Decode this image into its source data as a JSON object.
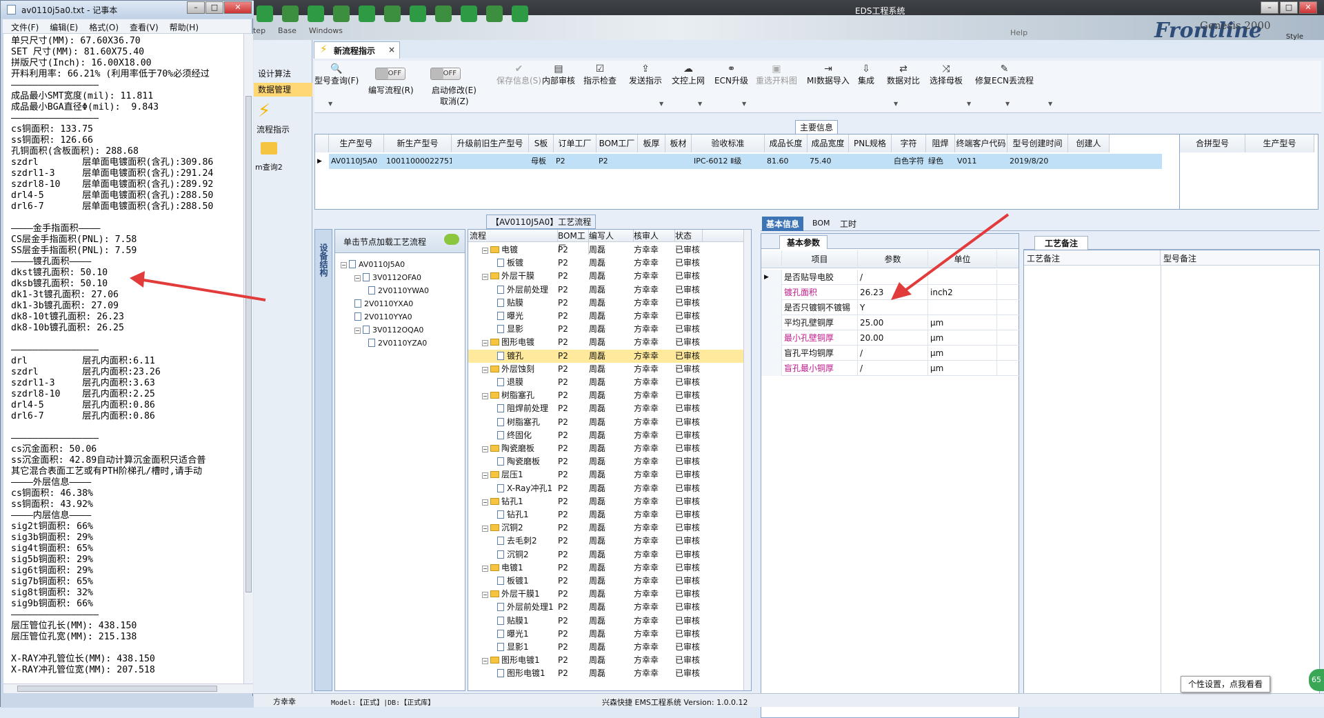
{
  "app": {
    "title": "EDS工程系统",
    "brand": "Frontline",
    "brand2": "Genesis 2000",
    "style_label": "Style",
    "menu_items": [
      "Step",
      "Base",
      "Windows"
    ],
    "menu_right": "Help"
  },
  "notepad": {
    "title": "av0110j5a0.txt - 记事本",
    "menu": [
      "文件(F)",
      "编辑(E)",
      "格式(O)",
      "查看(V)",
      "帮助(H)"
    ],
    "lines": [
      "单只尺寸(MM): 67.60X36.70",
      "SET 尺寸(MM): 81.60X75.40",
      "拼版尺寸(Inch): 16.00X18.00",
      "开料利用率: 66.21% (利用率低于70%必须经过",
      "————————————————",
      "成品最小SMT宽度(mil): 11.811",
      "成品最小BGA直径Φ(mil):  9.843",
      "————————————————",
      "cs铜面积: 133.75",
      "ss铜面积: 126.66",
      "孔铜面积(含板面积): 288.68",
      "szdrl        层单面电镀面积(含孔):309.86",
      "szdrl1-3     层单面电镀面积(含孔):291.24",
      "szdrl8-10    层单面电镀面积(含孔):289.92",
      "drl4-5       层单面电镀面积(含孔):288.50",
      "drl6-7       层单面电镀面积(含孔):288.50",
      "",
      "————金手指面积————",
      "CS层金手指面积(PNL): 7.58",
      "SS层金手指面积(PNL): 7.59",
      "————镀孔面积————",
      "dkst镀孔面积: 50.10",
      "dksb镀孔面积: 50.10",
      "dk1-3t镀孔面积: 27.06",
      "dk1-3b镀孔面积: 27.09",
      "dk8-10t镀孔面积: 26.23",
      "dk8-10b镀孔面积: 26.25",
      "",
      "————————————————",
      "drl          层孔内面积:6.11",
      "szdrl        层孔内面积:23.26",
      "szdrl1-3     层孔内面积:3.63",
      "szdrl8-10    层孔内面积:2.25",
      "drl4-5       层孔内面积:0.86",
      "drl6-7       层孔内面积:0.86",
      "",
      "————————————————",
      "cs沉金面积: 50.06",
      "ss沉金面积: 42.89自动计算沉金面积只适合普",
      "其它混合表面工艺或有PTH阶梯孔/槽时,请手动",
      "————外层信息————",
      "cs铜面积: 46.38%",
      "ss铜面积: 43.92%",
      "————内层信息————",
      "sig2t铜面积: 66%",
      "sig3b铜面积: 29%",
      "sig4t铜面积: 65%",
      "sig5b铜面积: 29%",
      "sig6t铜面积: 29%",
      "sig7b铜面积: 65%",
      "sig8t铜面积: 32%",
      "sig9b铜面积: 66%",
      "————————————————",
      "层压管位孔长(MM): 438.150",
      "层压管位孔宽(MM): 215.138",
      "",
      "X-RAY冲孔管位长(MM): 438.150",
      "X-RAY冲孔管位宽(MM): 207.518"
    ]
  },
  "nav": {
    "items": [
      "设计算法",
      "数据管理",
      "流程指示",
      "m查询2"
    ]
  },
  "tab": {
    "label": "新流程指示",
    "close": "×"
  },
  "toolbar": {
    "items": [
      {
        "label": "型号查询(F)",
        "icon": "search-icon",
        "enabled": true
      },
      {
        "label": "编写流程(R)",
        "icon": "toggle",
        "enabled": true
      },
      {
        "label": "启动修改(E)",
        "icon": "toggle",
        "enabled": true
      },
      {
        "label": "保存信息(S)",
        "icon": "check-icon",
        "enabled": false
      },
      {
        "label": "内部审核",
        "icon": "print-icon",
        "enabled": true
      },
      {
        "label": "指示检查",
        "icon": "checklist-icon",
        "enabled": true
      },
      {
        "label": "发送指示",
        "icon": "upload-icon",
        "enabled": true
      },
      {
        "label": "文控上网",
        "icon": "cloud-icon",
        "enabled": true
      },
      {
        "label": "ECN升级",
        "icon": "binoculars-icon",
        "enabled": true
      },
      {
        "label": "重选开料图",
        "icon": "image-icon",
        "enabled": false
      },
      {
        "label": "MI数据导入",
        "icon": "import-icon",
        "enabled": true
      },
      {
        "label": "集成",
        "icon": "download-icon",
        "enabled": true
      },
      {
        "label": "数据对比",
        "icon": "compare-icon",
        "enabled": true
      },
      {
        "label": "选择母板",
        "icon": "shuffle-icon",
        "enabled": true
      },
      {
        "label": "修复ECN丢流程",
        "icon": "wrench-icon",
        "enabled": true
      }
    ],
    "toggle_off": "OFF",
    "cancel_label": "取消(Z)"
  },
  "main_info": {
    "title": "主要信息",
    "columns": [
      "生产型号",
      "新生产型号",
      "升级前旧生产型号",
      "S板",
      "订单工厂",
      "BOM工厂",
      "板厚",
      "板材",
      "验收标准",
      "成品长度",
      "成品宽度",
      "PNL规格",
      "字符",
      "阻焊",
      "终端客户代码",
      "型号创建时间",
      "创建人"
    ],
    "row": [
      "AV0110J5A0",
      "10011000022751",
      "",
      "母板",
      "P2",
      "P2",
      "",
      "",
      "IPC-6012 Ⅱ级",
      "81.60",
      "75.40",
      "",
      "白色字符",
      "绿色",
      "V011",
      "2019/8/20",
      ""
    ],
    "right_columns": [
      "合拼型号",
      "生产型号"
    ]
  },
  "tree": {
    "header": "单击节点加载工艺流程",
    "side_label": "设备结构",
    "nodes": [
      "AV0110J5A0",
      "3V0112OFA0",
      "2V0110YWA0",
      "2V0110YXA0",
      "2V0110YYA0",
      "3V0112OQA0",
      "2V0110YZA0"
    ]
  },
  "flow": {
    "title": "【AV0110J5A0】工艺流程",
    "columns": [
      "流程",
      "BOM工厂",
      "编写人",
      "核审人",
      "状态"
    ],
    "rows": [
      {
        "name": "电镀",
        "type": "folder",
        "bom": "P2",
        "writer": "周磊",
        "reviewer": "方幸幸",
        "status": "已审核"
      },
      {
        "name": "板镀",
        "type": "doc",
        "bom": "P2",
        "writer": "周磊",
        "reviewer": "方幸幸",
        "status": "已审核"
      },
      {
        "name": "外层干膜",
        "type": "folder",
        "bom": "P2",
        "writer": "周磊",
        "reviewer": "方幸幸",
        "status": "已审核"
      },
      {
        "name": "外层前处理",
        "type": "doc",
        "bom": "P2",
        "writer": "周磊",
        "reviewer": "方幸幸",
        "status": "已审核"
      },
      {
        "name": "贴膜",
        "type": "doc",
        "bom": "P2",
        "writer": "周磊",
        "reviewer": "方幸幸",
        "status": "已审核"
      },
      {
        "name": "曝光",
        "type": "doc",
        "bom": "P2",
        "writer": "周磊",
        "reviewer": "方幸幸",
        "status": "已审核"
      },
      {
        "name": "显影",
        "type": "doc",
        "bom": "P2",
        "writer": "周磊",
        "reviewer": "方幸幸",
        "status": "已审核"
      },
      {
        "name": "图形电镀",
        "type": "folder",
        "bom": "P2",
        "writer": "周磊",
        "reviewer": "方幸幸",
        "status": "已审核"
      },
      {
        "name": "镀孔",
        "type": "doc",
        "bom": "P2",
        "writer": "周磊",
        "reviewer": "方幸幸",
        "status": "已审核",
        "selected": true
      },
      {
        "name": "外层蚀刻",
        "type": "folder",
        "bom": "P2",
        "writer": "周磊",
        "reviewer": "方幸幸",
        "status": "已审核"
      },
      {
        "name": "退膜",
        "type": "doc",
        "bom": "P2",
        "writer": "周磊",
        "reviewer": "方幸幸",
        "status": "已审核"
      },
      {
        "name": "树脂塞孔",
        "type": "folder",
        "bom": "P2",
        "writer": "周磊",
        "reviewer": "方幸幸",
        "status": "已审核"
      },
      {
        "name": "阻焊前处理",
        "type": "doc",
        "bom": "P2",
        "writer": "周磊",
        "reviewer": "方幸幸",
        "status": "已审核"
      },
      {
        "name": "树脂塞孔",
        "type": "doc",
        "bom": "P2",
        "writer": "周磊",
        "reviewer": "方幸幸",
        "status": "已审核"
      },
      {
        "name": "终固化",
        "type": "doc",
        "bom": "P2",
        "writer": "周磊",
        "reviewer": "方幸幸",
        "status": "已审核"
      },
      {
        "name": "陶瓷磨板",
        "type": "folder",
        "bom": "P2",
        "writer": "周磊",
        "reviewer": "方幸幸",
        "status": "已审核"
      },
      {
        "name": "陶瓷磨板",
        "type": "doc",
        "bom": "P2",
        "writer": "周磊",
        "reviewer": "方幸幸",
        "status": "已审核"
      },
      {
        "name": "层压1",
        "type": "folder",
        "bom": "P2",
        "writer": "周磊",
        "reviewer": "方幸幸",
        "status": "已审核"
      },
      {
        "name": "X-Ray冲孔1",
        "type": "doc",
        "bom": "P2",
        "writer": "周磊",
        "reviewer": "方幸幸",
        "status": "已审核"
      },
      {
        "name": "钻孔1",
        "type": "folder",
        "bom": "P2",
        "writer": "周磊",
        "reviewer": "方幸幸",
        "status": "已审核"
      },
      {
        "name": "钻孔1",
        "type": "doc",
        "bom": "P2",
        "writer": "周磊",
        "reviewer": "方幸幸",
        "status": "已审核"
      },
      {
        "name": "沉铜2",
        "type": "folder",
        "bom": "P2",
        "writer": "周磊",
        "reviewer": "方幸幸",
        "status": "已审核"
      },
      {
        "name": "去毛刺2",
        "type": "doc",
        "bom": "P2",
        "writer": "周磊",
        "reviewer": "方幸幸",
        "status": "已审核"
      },
      {
        "name": "沉铜2",
        "type": "doc",
        "bom": "P2",
        "writer": "周磊",
        "reviewer": "方幸幸",
        "status": "已审核"
      },
      {
        "name": "电镀1",
        "type": "folder",
        "bom": "P2",
        "writer": "周磊",
        "reviewer": "方幸幸",
        "status": "已审核"
      },
      {
        "name": "板镀1",
        "type": "doc",
        "bom": "P2",
        "writer": "周磊",
        "reviewer": "方幸幸",
        "status": "已审核"
      },
      {
        "name": "外层干膜1",
        "type": "folder",
        "bom": "P2",
        "writer": "周磊",
        "reviewer": "方幸幸",
        "status": "已审核"
      },
      {
        "name": "外层前处理1",
        "type": "doc",
        "bom": "P2",
        "writer": "周磊",
        "reviewer": "方幸幸",
        "status": "已审核"
      },
      {
        "name": "贴膜1",
        "type": "doc",
        "bom": "P2",
        "writer": "周磊",
        "reviewer": "方幸幸",
        "status": "已审核"
      },
      {
        "name": "曝光1",
        "type": "doc",
        "bom": "P2",
        "writer": "周磊",
        "reviewer": "方幸幸",
        "status": "已审核"
      },
      {
        "name": "显影1",
        "type": "doc",
        "bom": "P2",
        "writer": "周磊",
        "reviewer": "方幸幸",
        "status": "已审核"
      },
      {
        "name": "图形电镀1",
        "type": "folder",
        "bom": "P2",
        "writer": "周磊",
        "reviewer": "方幸幸",
        "status": "已审核"
      },
      {
        "name": "图形电镀1",
        "type": "doc",
        "bom": "P2",
        "writer": "周磊",
        "reviewer": "方幸幸",
        "status": "已审核"
      }
    ]
  },
  "detail_tabs": [
    "基本信息",
    "BOM",
    "工时"
  ],
  "basic": {
    "tab": "基本参数",
    "columns": [
      "项目",
      "参数",
      "单位"
    ],
    "rows": [
      {
        "item": "是否贴导电胶",
        "param": "/",
        "unit": "",
        "pink": false
      },
      {
        "item": "镀孔面积",
        "param": "26.23",
        "unit": "inch2",
        "pink": true
      },
      {
        "item": "是否只镀铜不镀锡",
        "param": "Y",
        "unit": "",
        "pink": false
      },
      {
        "item": "平均孔壁铜厚",
        "param": "25.00",
        "unit": "μm",
        "pink": false
      },
      {
        "item": "最小孔壁铜厚",
        "param": "20.00",
        "unit": "μm",
        "pink": true
      },
      {
        "item": "盲孔平均铜厚",
        "param": "/",
        "unit": "μm",
        "pink": false
      },
      {
        "item": "盲孔最小铜厚",
        "param": "/",
        "unit": "μm",
        "pink": true
      }
    ]
  },
  "remark": {
    "tab": "工艺备注",
    "columns": [
      "工艺备注",
      "型号备注"
    ]
  },
  "status": {
    "user": "方幸幸",
    "model": "Model:【正式】|DB:【正式库】",
    "system": "兴森快捷  EMS工程系统  Version: 1.0.0.12",
    "tooltip": "个性设置，点我看看",
    "badge": "65"
  },
  "colors": {
    "accent": "#ffd774",
    "selected_row": "#bfe0f7",
    "pink": "#c0198b",
    "arrow": "#e23b3b"
  }
}
